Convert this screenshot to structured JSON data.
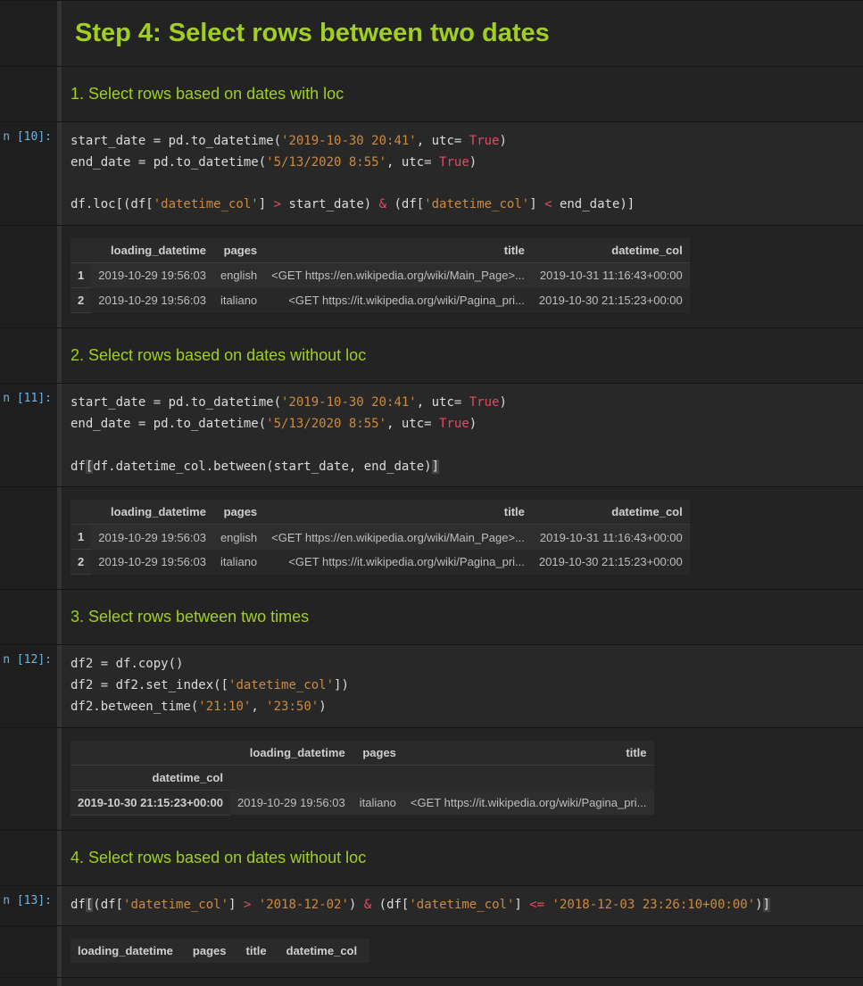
{
  "step_title": "Step 4: Select rows between two dates",
  "sections": {
    "s1": {
      "title": "1. Select rows based on dates with loc",
      "prompt": "n [10]:",
      "code_html": "start_date <span class='tok-eq'>=</span> pd.to_datetime(<span class='tok-str'>'2019-10-30 20:41'</span>, utc<span class='tok-eq'>=</span> <span class='tok-kw'>True</span>)\nend_date <span class='tok-eq'>=</span> pd.to_datetime(<span class='tok-str'>'5/13/2020 8:55'</span>, utc<span class='tok-eq'>=</span> <span class='tok-kw'>True</span>)\n\ndf.loc[(df[<span class='tok-str'>'datetime_col'</span>] <span class='tok-kw'>&gt;</span> start_date) <span class='tok-kw'>&amp;</span> (df[<span class='tok-str'>'datetime_col'</span>] <span class='tok-kw'>&lt;</span> end_date)]",
      "table": {
        "headers": [
          "",
          "loading_datetime",
          "pages",
          "title",
          "datetime_col"
        ],
        "rows": [
          [
            "1",
            "2019-10-29 19:56:03",
            "english",
            "<GET https://en.wikipedia.org/wiki/Main_Page>...",
            "2019-10-31 11:16:43+00:00"
          ],
          [
            "2",
            "2019-10-29 19:56:03",
            "italiano",
            "<GET https://it.wikipedia.org/wiki/Pagina_pri...",
            "2019-10-30 21:15:23+00:00"
          ]
        ]
      }
    },
    "s2": {
      "title": "2. Select rows based on dates without loc",
      "prompt": "n [11]:",
      "code_html": "start_date <span class='tok-eq'>=</span> pd.to_datetime(<span class='tok-str'>'2019-10-30 20:41'</span>, utc<span class='tok-eq'>=</span> <span class='tok-kw'>True</span>)\nend_date <span class='tok-eq'>=</span> pd.to_datetime(<span class='tok-str'>'5/13/2020 8:55'</span>, utc<span class='tok-eq'>=</span> <span class='tok-kw'>True</span>)\n\ndf<span class='tok-hl'>[</span>df.datetime_col.between(start_date, end_date)<span class='tok-hl'>]</span>",
      "table": {
        "headers": [
          "",
          "loading_datetime",
          "pages",
          "title",
          "datetime_col"
        ],
        "rows": [
          [
            "1",
            "2019-10-29 19:56:03",
            "english",
            "<GET https://en.wikipedia.org/wiki/Main_Page>...",
            "2019-10-31 11:16:43+00:00"
          ],
          [
            "2",
            "2019-10-29 19:56:03",
            "italiano",
            "<GET https://it.wikipedia.org/wiki/Pagina_pri...",
            "2019-10-30 21:15:23+00:00"
          ]
        ]
      }
    },
    "s3": {
      "title": "3. Select rows between two times",
      "prompt": "n [12]:",
      "code_html": "df2 <span class='tok-eq'>=</span> df.copy()\ndf2 <span class='tok-eq'>=</span> df2.set_index([<span class='tok-str'>'datetime_col'</span>])\ndf2.between_time(<span class='tok-str'>'21:10'</span>, <span class='tok-str'>'23:50'</span>)",
      "table": {
        "index_name": "datetime_col",
        "headers": [
          "",
          "loading_datetime",
          "pages",
          "title"
        ],
        "rows": [
          [
            "2019-10-30 21:15:23+00:00",
            "2019-10-29 19:56:03",
            "italiano",
            "<GET https://it.wikipedia.org/wiki/Pagina_pri..."
          ]
        ]
      }
    },
    "s4": {
      "title": "4. Select rows based on dates without loc",
      "prompt": "n [13]:",
      "code_html": "df<span class='tok-hl'>[</span>(df[<span class='tok-str'>'datetime_col'</span>] <span class='tok-kw'>&gt;</span> <span class='tok-str'>'2018-12-02'</span>) <span class='tok-kw'>&amp;</span> (df[<span class='tok-str'>'datetime_col'</span>] <span class='tok-kw'>&lt;=</span> <span class='tok-str'>'2018-12-03 23:26:10+00:00'</span>)<span class='tok-hl'>]</span>",
      "table": {
        "headers": [
          "loading_datetime",
          "pages",
          "title",
          "datetime_col"
        ],
        "rows": []
      }
    }
  }
}
